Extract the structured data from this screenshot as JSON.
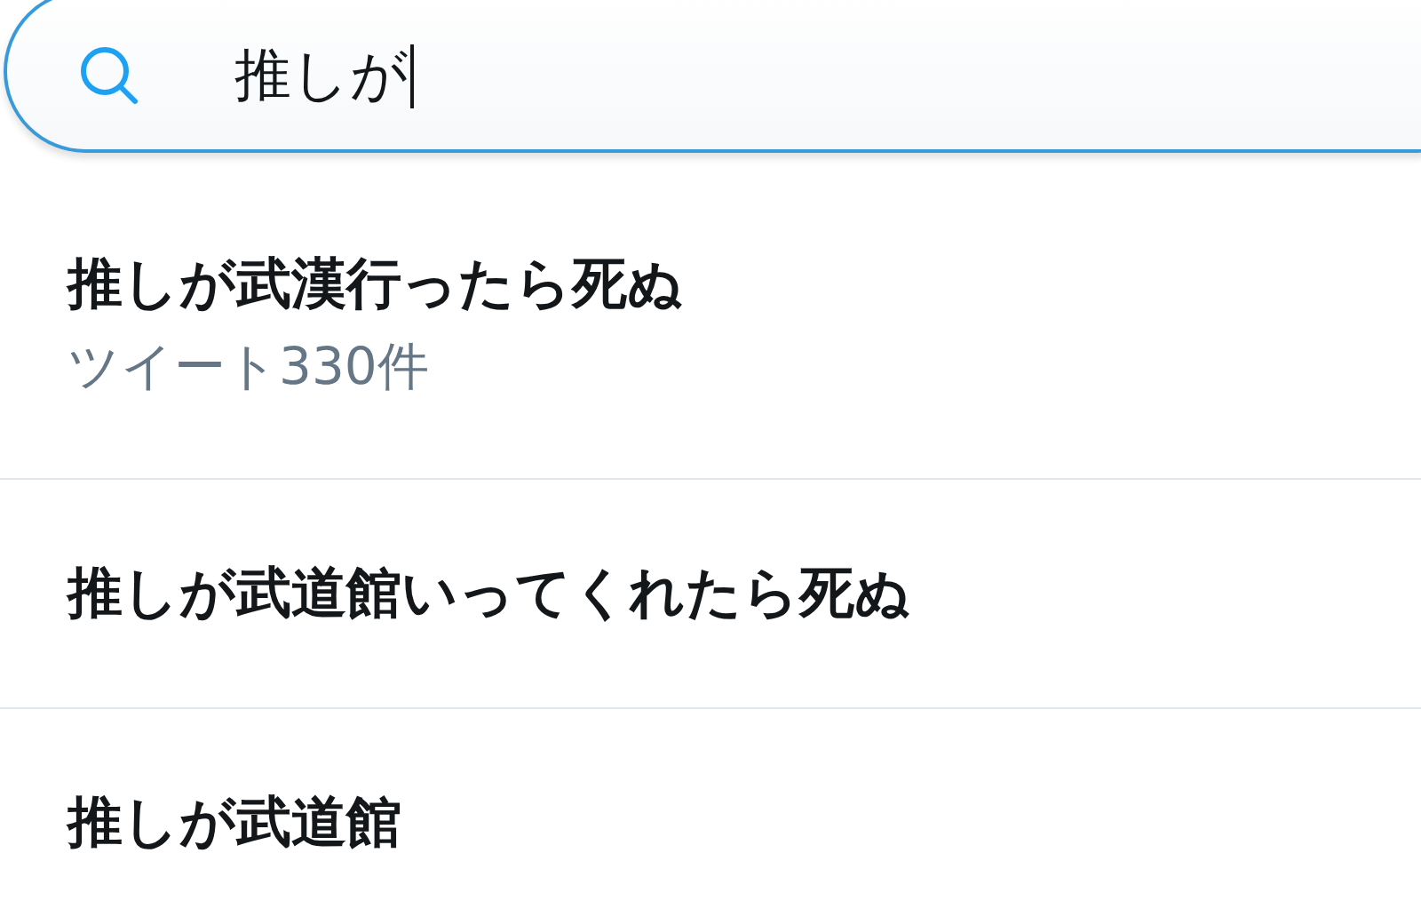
{
  "search": {
    "value": "推しが"
  },
  "suggestions": [
    {
      "text": "推しが武漢行ったら死ぬ",
      "detail": "ツイート330件"
    },
    {
      "text": "推しが武道館いってくれたら死ぬ"
    },
    {
      "text": "推しが武道館"
    }
  ]
}
